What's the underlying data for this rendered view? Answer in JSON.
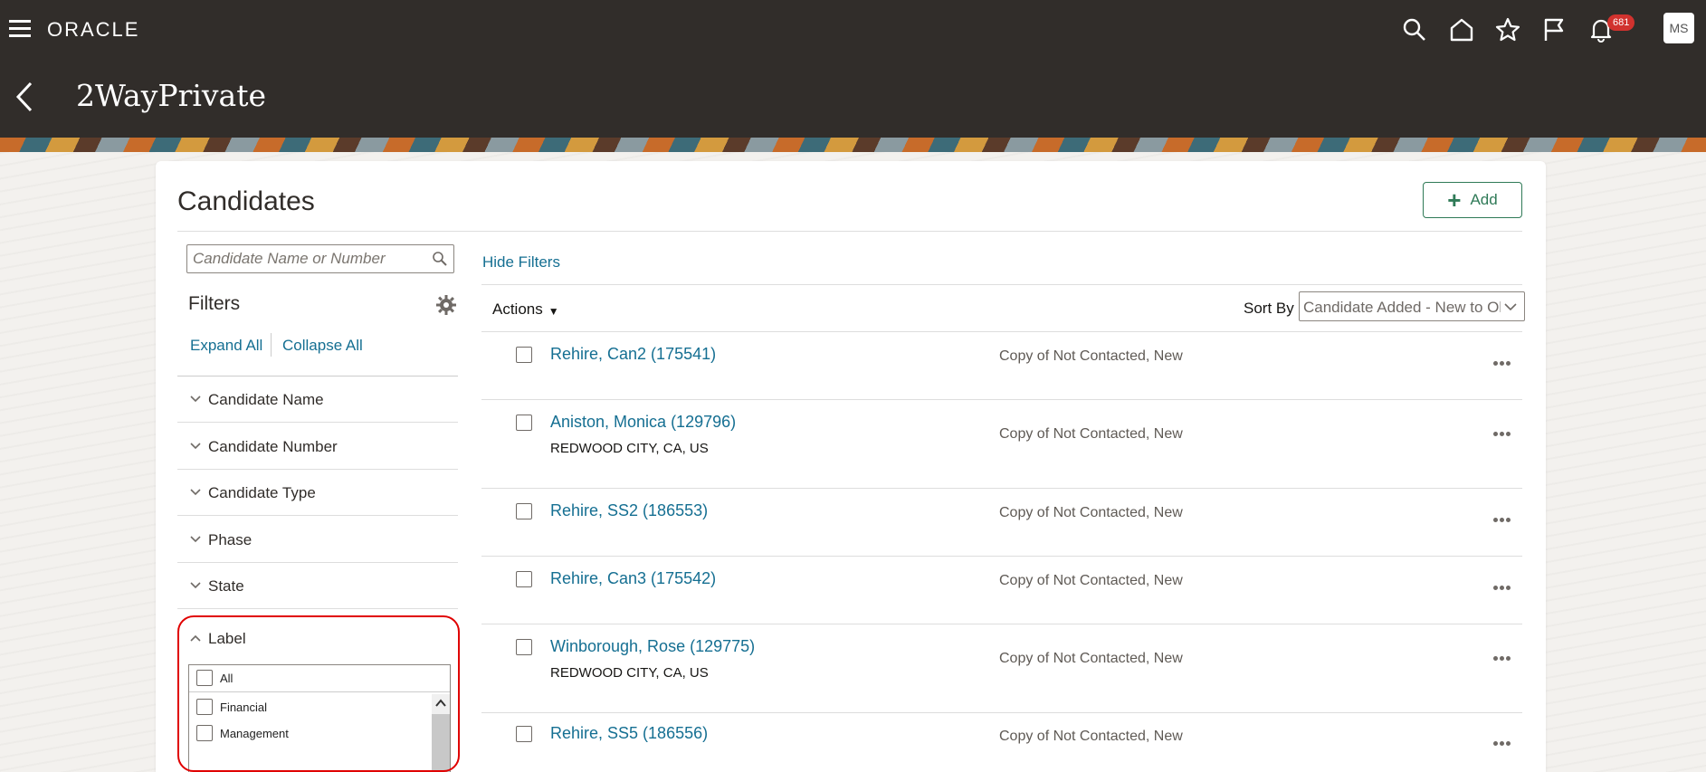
{
  "header": {
    "brand": "ORACLE",
    "page_title": "2WayPrivate",
    "notification_count": "681",
    "user_initials": "MS",
    "icons": [
      "menu-icon",
      "search-icon",
      "home-icon",
      "star-icon",
      "flag-icon",
      "bell-icon"
    ]
  },
  "card": {
    "title": "Candidates",
    "add_label": "Add"
  },
  "filters": {
    "search_placeholder": "Candidate Name or Number",
    "title": "Filters",
    "expand_all": "Expand All",
    "collapse_all": "Collapse All",
    "facets": [
      "Candidate Name",
      "Candidate Number",
      "Candidate Type",
      "Phase",
      "State"
    ],
    "label_facet": {
      "title": "Label",
      "options": [
        "All",
        "Financial",
        "Management"
      ]
    }
  },
  "toolbar": {
    "hide_filters": "Hide Filters",
    "actions": "Actions",
    "sort_by_label": "Sort By",
    "sort_value": "Candidate Added - New to Old"
  },
  "candidates": [
    {
      "name": "Rehire, Can2 (175541)",
      "location": "",
      "status": "Copy of Not Contacted, New"
    },
    {
      "name": "Aniston, Monica (129796)",
      "location": "REDWOOD CITY, CA, US",
      "status": "Copy of Not Contacted, New"
    },
    {
      "name": "Rehire, SS2 (186553)",
      "location": "",
      "status": "Copy of Not Contacted, New"
    },
    {
      "name": "Rehire, Can3 (175542)",
      "location": "",
      "status": "Copy of Not Contacted, New"
    },
    {
      "name": "Winborough, Rose (129775)",
      "location": "REDWOOD CITY, CA, US",
      "status": "Copy of Not Contacted, New"
    },
    {
      "name": "Rehire, SS5 (186556)",
      "location": "",
      "status": "Copy of Not Contacted, New"
    }
  ],
  "colors": {
    "header_bg": "#312d2a",
    "link": "#156f92",
    "add_button": "#2f7a57",
    "badge": "#d1322e",
    "highlight": "#e00000"
  }
}
